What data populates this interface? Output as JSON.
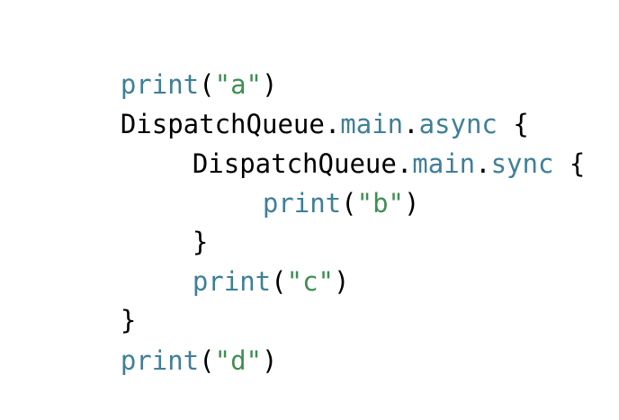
{
  "colors": {
    "background": "#ffffff",
    "plain": "#000000",
    "function": "#3f7f98",
    "string": "#3f8e52"
  },
  "code": {
    "lines": [
      [
        {
          "text": "print",
          "kind": "function"
        },
        {
          "text": "(",
          "kind": "plain"
        },
        {
          "text": "\"a\"",
          "kind": "string"
        },
        {
          "text": ")",
          "kind": "plain"
        }
      ],
      [
        {
          "text": "DispatchQueue.",
          "kind": "plain"
        },
        {
          "text": "main",
          "kind": "function"
        },
        {
          "text": ".",
          "kind": "plain"
        },
        {
          "text": "async",
          "kind": "function"
        },
        {
          "text": " {",
          "kind": "plain"
        }
      ],
      [
        {
          "text": "DispatchQueue.",
          "kind": "plain"
        },
        {
          "text": "main",
          "kind": "function"
        },
        {
          "text": ".",
          "kind": "plain"
        },
        {
          "text": "sync",
          "kind": "function"
        },
        {
          "text": " {",
          "kind": "plain"
        }
      ],
      [
        {
          "text": "print",
          "kind": "function"
        },
        {
          "text": "(",
          "kind": "plain"
        },
        {
          "text": "\"b\"",
          "kind": "string"
        },
        {
          "text": ")",
          "kind": "plain"
        }
      ],
      [
        {
          "text": "}",
          "kind": "plain"
        }
      ],
      [
        {
          "text": "print",
          "kind": "function"
        },
        {
          "text": "(",
          "kind": "plain"
        },
        {
          "text": "\"c\"",
          "kind": "string"
        },
        {
          "text": ")",
          "kind": "plain"
        }
      ],
      [
        {
          "text": "}",
          "kind": "plain"
        }
      ],
      [
        {
          "text": "print",
          "kind": "function"
        },
        {
          "text": "(",
          "kind": "plain"
        },
        {
          "text": "\"d\"",
          "kind": "string"
        },
        {
          "text": ")",
          "kind": "plain"
        }
      ]
    ]
  }
}
